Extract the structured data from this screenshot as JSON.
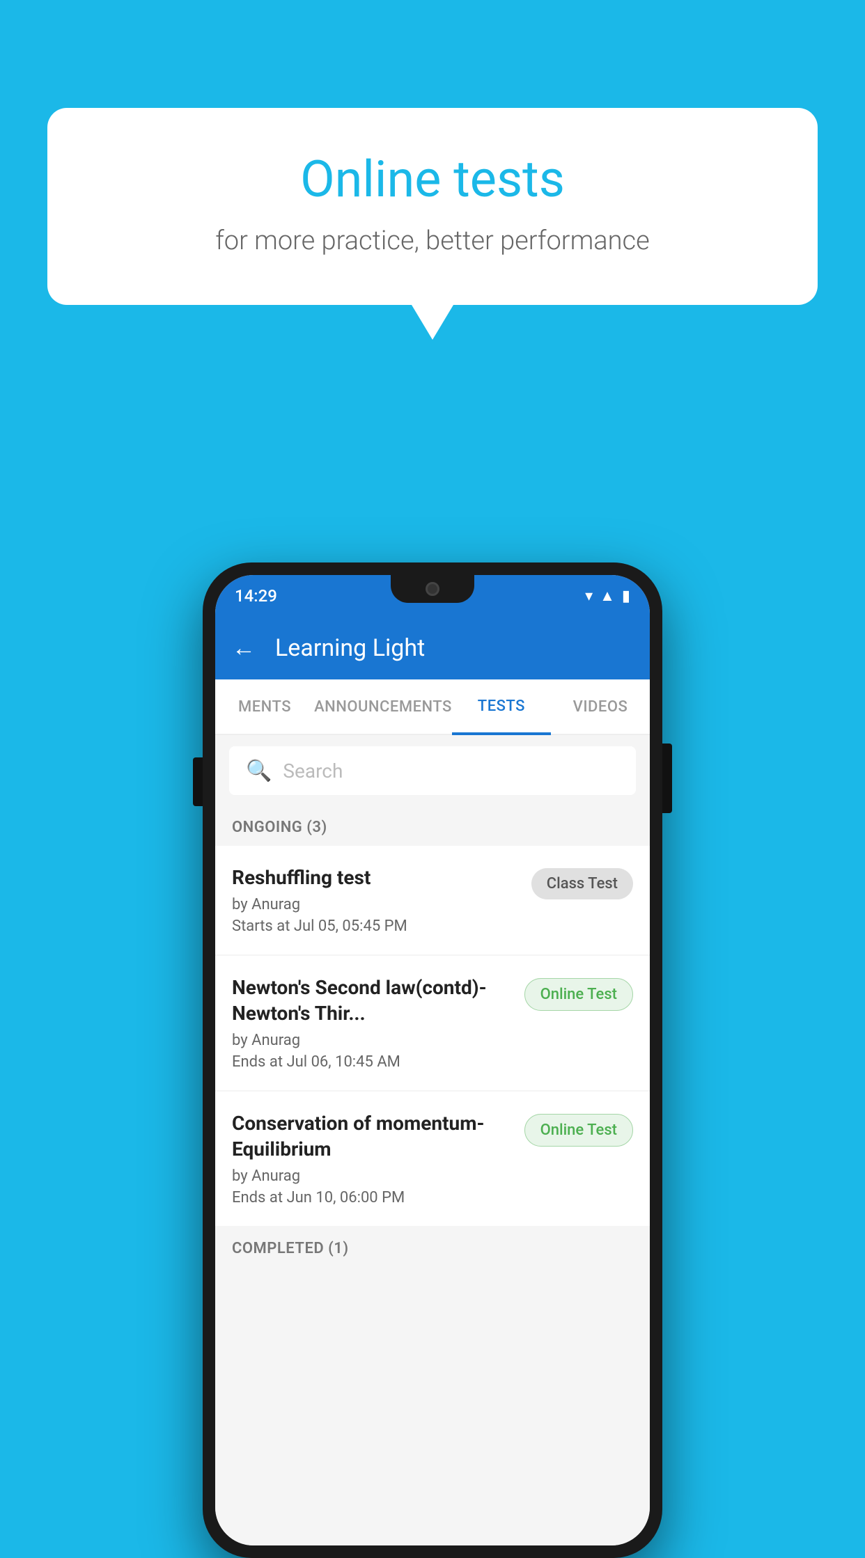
{
  "background": {
    "color": "#1bb8e8"
  },
  "speech_bubble": {
    "title": "Online tests",
    "subtitle": "for more practice, better performance"
  },
  "status_bar": {
    "time": "14:29",
    "icons": [
      "wifi",
      "signal",
      "battery"
    ]
  },
  "app_bar": {
    "title": "Learning Light",
    "back_label": "←"
  },
  "tabs": [
    {
      "label": "MENTS",
      "active": false
    },
    {
      "label": "ANNOUNCEMENTS",
      "active": false
    },
    {
      "label": "TESTS",
      "active": true
    },
    {
      "label": "VIDEOS",
      "active": false
    }
  ],
  "search": {
    "placeholder": "Search"
  },
  "ongoing_section": {
    "header": "ONGOING (3)",
    "tests": [
      {
        "name": "Reshuffling test",
        "author": "by Anurag",
        "date": "Starts at  Jul 05, 05:45 PM",
        "badge": "Class Test",
        "badge_type": "class"
      },
      {
        "name": "Newton's Second law(contd)-Newton's Thir...",
        "author": "by Anurag",
        "date": "Ends at  Jul 06, 10:45 AM",
        "badge": "Online Test",
        "badge_type": "online"
      },
      {
        "name": "Conservation of momentum-Equilibrium",
        "author": "by Anurag",
        "date": "Ends at  Jun 10, 06:00 PM",
        "badge": "Online Test",
        "badge_type": "online"
      }
    ]
  },
  "completed_section": {
    "header": "COMPLETED (1)"
  }
}
